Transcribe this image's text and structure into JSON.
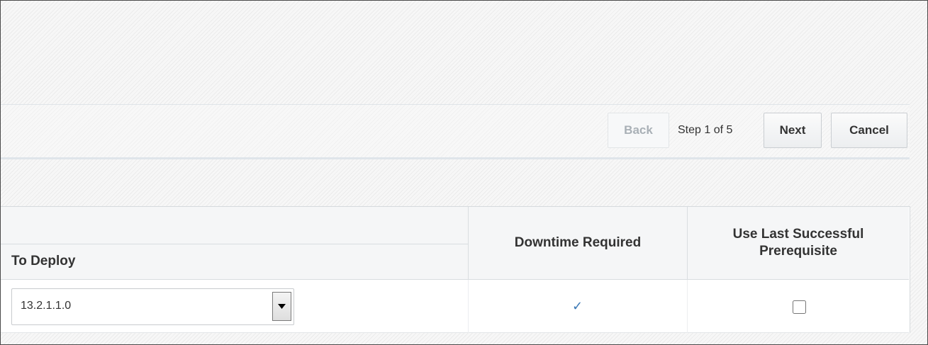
{
  "wizard": {
    "back_label": "Back",
    "step_text": "Step 1 of 5",
    "next_label": "Next",
    "cancel_label": "Cancel"
  },
  "table": {
    "columns": {
      "to_deploy": "To Deploy",
      "downtime_required": "Downtime Required",
      "use_last_successful": "Use Last Successful Prerequisite"
    },
    "rows": [
      {
        "to_deploy_value": "13.2.1.1.0",
        "downtime_required": true,
        "use_last_successful": false
      }
    ]
  },
  "icons": {
    "dropdown": "chevron-down-icon",
    "downtime": "check-icon"
  },
  "colors": {
    "accent": "#3a78b5",
    "disabled_text": "#a9b0b6"
  }
}
